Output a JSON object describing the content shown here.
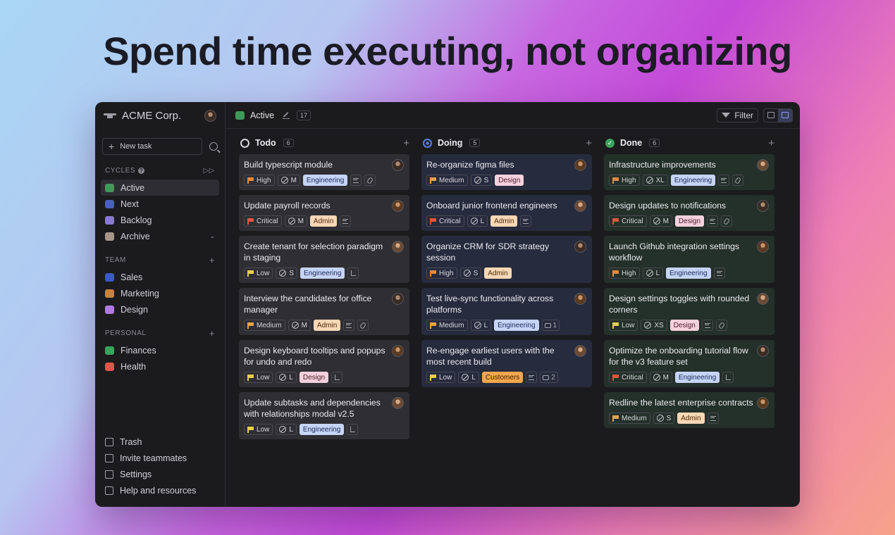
{
  "headline": "Spend time executing, not organizing",
  "colors": {
    "engineering": "#c6d4f7",
    "design": "#f6d1dd",
    "admin": "#f9d8b6",
    "customers": "#f3a64b",
    "critical": "#e0553c",
    "high": "#e8893a",
    "medium": "#e8a24a",
    "low": "#e8cf4a"
  },
  "sidebar": {
    "org_name": "ACME Corp.",
    "new_task": "New task",
    "cycles_title": "CYCLES",
    "cycles": [
      {
        "label": "Active",
        "icon": "active-cycle-icon",
        "color": "#3f9a5a"
      },
      {
        "label": "Next",
        "icon": "next-cycle-icon",
        "color": "#4a5fc4"
      },
      {
        "label": "Backlog",
        "icon": "backlog-icon",
        "color": "#8a78d8"
      },
      {
        "label": "Archive",
        "icon": "archive-icon",
        "color": "#a8958a"
      }
    ],
    "team_title": "TEAM",
    "team": [
      {
        "label": "Sales",
        "icon": "sales-icon",
        "color": "#3a5ac8"
      },
      {
        "label": "Marketing",
        "icon": "marketing-icon",
        "color": "#c8843a"
      },
      {
        "label": "Design",
        "icon": "design-wand-icon",
        "color": "#b07ae0"
      }
    ],
    "personal_title": "PERSONAL",
    "personal": [
      {
        "label": "Finances",
        "icon": "finances-icon",
        "color": "#3aa35d"
      },
      {
        "label": "Health",
        "icon": "health-heart-icon",
        "color": "#e0554a"
      }
    ],
    "bottom": [
      {
        "label": "Trash",
        "icon": "trash-icon"
      },
      {
        "label": "Invite teammates",
        "icon": "invite-icon"
      },
      {
        "label": "Settings",
        "icon": "settings-icon"
      },
      {
        "label": "Help and resources",
        "icon": "help-icon"
      }
    ]
  },
  "topbar": {
    "title": "Active",
    "count": "17",
    "filter": "Filter"
  },
  "columns": [
    {
      "title": "Todo",
      "count": "6",
      "cards": [
        {
          "title": "Build typescript module",
          "priority": "High",
          "size": "M",
          "label": "Engineering",
          "extras": [
            "lines",
            "clip"
          ]
        },
        {
          "title": "Update payroll records",
          "priority": "Critical",
          "size": "M",
          "label": "Admin",
          "extras": [
            "lines"
          ]
        },
        {
          "title": "Create tenant for selection paradigm in staging",
          "priority": "Low",
          "size": "S",
          "label": "Engineering",
          "extras": [
            "sub"
          ]
        },
        {
          "title": "Interview the candidates for office manager",
          "priority": "Medium",
          "size": "M",
          "label": "Admin",
          "extras": [
            "lines",
            "clip"
          ]
        },
        {
          "title": "Design keyboard tooltips and popups for undo and redo",
          "priority": "Low",
          "size": "L",
          "label": "Design",
          "extras": [
            "sub"
          ]
        },
        {
          "title": "Update subtasks and dependencies with relationships modal v2.5",
          "priority": "Low",
          "size": "L",
          "label": "Engineering",
          "extras": [
            "sub"
          ]
        }
      ]
    },
    {
      "title": "Doing",
      "count": "5",
      "cards": [
        {
          "title": "Re-organize figma files",
          "priority": "Medium",
          "size": "S",
          "label": "Design",
          "extras": []
        },
        {
          "title": "Onboard junior frontend engineers",
          "priority": "Critical",
          "size": "L",
          "label": "Admin",
          "extras": [
            "lines"
          ]
        },
        {
          "title": "Organize CRM for SDR strategy session",
          "priority": "High",
          "size": "S",
          "label": "Admin",
          "extras": []
        },
        {
          "title": "Test live-sync functionality across platforms",
          "priority": "Medium",
          "size": "L",
          "label": "Engineering",
          "extras": [
            "rel:1"
          ]
        },
        {
          "title": "Re-engage earliest users with the most recent build",
          "priority": "Low",
          "size": "L",
          "label": "Customers",
          "extras": [
            "lines",
            "rel:2"
          ]
        }
      ]
    },
    {
      "title": "Done",
      "count": "6",
      "cards": [
        {
          "title": "Infrastructure improvements",
          "priority": "High",
          "size": "XL",
          "label": "Engineering",
          "extras": [
            "lines",
            "clip"
          ]
        },
        {
          "title": "Design updates to notifications",
          "priority": "Critical",
          "size": "M",
          "label": "Design",
          "extras": [
            "lines",
            "clip"
          ]
        },
        {
          "title": "Launch Github integration settings workflow",
          "priority": "High",
          "size": "L",
          "label": "Engineering",
          "extras": [
            "lines"
          ]
        },
        {
          "title": "Design settings toggles with rounded corners",
          "priority": "Low",
          "size": "XS",
          "label": "Design",
          "extras": [
            "lines",
            "clip"
          ]
        },
        {
          "title": "Optimize the onboarding tutorial flow for the v3 feature set",
          "priority": "Critical",
          "size": "M",
          "label": "Engineering",
          "extras": [
            "sub"
          ]
        },
        {
          "title": "Redline the latest enterprise contracts",
          "priority": "Medium",
          "size": "S",
          "label": "Admin",
          "extras": [
            "lines"
          ]
        }
      ]
    }
  ]
}
